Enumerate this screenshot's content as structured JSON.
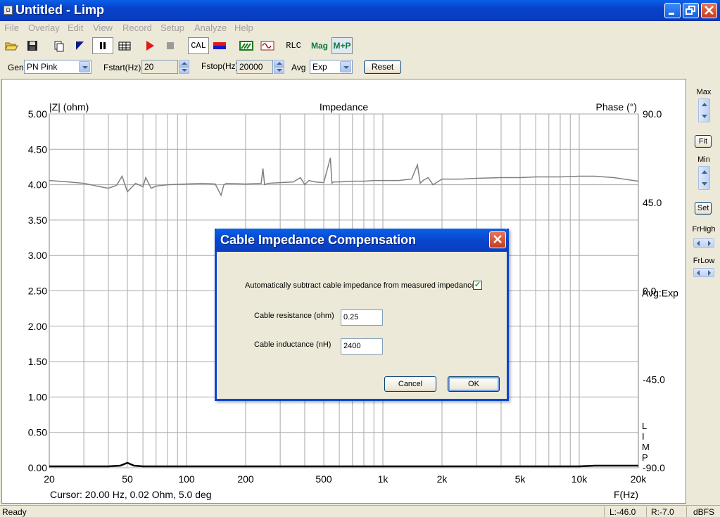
{
  "window": {
    "title": "Untitled - Limp",
    "app_icon_glyph": "Ω"
  },
  "menu": [
    "File",
    "Overlay",
    "Edit",
    "View",
    "Record",
    "Setup",
    "Analyze",
    "Help"
  ],
  "toolbar": {
    "cal_label": "CAL",
    "rlc_label": "RLC",
    "mag_label": "Mag",
    "mp_label": "M+P"
  },
  "params": {
    "gen_label": "Gen",
    "gen_value": "PN Pink",
    "fstart_label": "Fstart(Hz)",
    "fstart_value": "20",
    "fstop_label": "Fstop(Hz)",
    "fstop_value": "20000",
    "avg_label": "Avg",
    "avg_value": "Exp",
    "reset_label": "Reset"
  },
  "side": {
    "max_label": "Max",
    "fit_label": "Fit",
    "min_label": "Min",
    "set_label": "Set",
    "frhigh_label": "FrHigh",
    "frlow_label": "FrLow"
  },
  "chart_data": {
    "type": "line",
    "title": "Impedance",
    "ylabel": "|Z| (ohm)",
    "y2label": "Phase (°)",
    "xlabel": "F(Hz)",
    "xscale": "log",
    "xlim": [
      20,
      20000
    ],
    "ylim": [
      0,
      5
    ],
    "y2lim": [
      -90,
      90
    ],
    "xticks": [
      {
        "v": 20,
        "t": "20"
      },
      {
        "v": 50,
        "t": "50"
      },
      {
        "v": 100,
        "t": "100"
      },
      {
        "v": 200,
        "t": "200"
      },
      {
        "v": 500,
        "t": "500"
      },
      {
        "v": 1000,
        "t": "1k"
      },
      {
        "v": 2000,
        "t": "2k"
      },
      {
        "v": 5000,
        "t": "5k"
      },
      {
        "v": 10000,
        "t": "10k"
      },
      {
        "v": 20000,
        "t": "20k"
      }
    ],
    "yticks": [
      "0.00",
      "0.50",
      "1.00",
      "1.50",
      "2.00",
      "2.50",
      "3.00",
      "3.50",
      "4.00",
      "4.50",
      "5.00"
    ],
    "y2ticks": [
      {
        "v": 90,
        "t": "90.0"
      },
      {
        "v": 45,
        "t": "45.0"
      },
      {
        "v": 0,
        "t": "0.0"
      },
      {
        "v": -45,
        "t": "-45.0"
      },
      {
        "v": -90,
        "t": "-90.0"
      }
    ],
    "avg_label": "Avg:Exp",
    "vertical_label": [
      "L",
      "I",
      "M",
      "P"
    ],
    "grid": true,
    "series": [
      {
        "color": "#808080",
        "x": [
          20,
          25,
          30,
          35,
          40,
          44,
          47,
          50,
          55,
          60,
          62,
          66,
          70,
          80,
          100,
          120,
          140,
          150,
          155,
          160,
          200,
          240,
          245,
          250,
          260,
          300,
          350,
          380,
          400,
          420,
          450,
          500,
          540,
          550,
          560,
          600,
          700,
          800,
          900,
          1000,
          1200,
          1400,
          1500,
          1550,
          1600,
          1700,
          1800,
          2000,
          2500,
          3000,
          4000,
          5000,
          6000,
          8000,
          10000,
          12000,
          15000,
          20000
        ],
        "y": [
          4.06,
          4.04,
          4.02,
          3.98,
          3.95,
          3.99,
          4.12,
          3.9,
          4.02,
          3.97,
          4.1,
          3.95,
          3.98,
          4.0,
          4.01,
          4.02,
          4.01,
          3.85,
          4.0,
          4.02,
          4.01,
          4.02,
          4.23,
          4.0,
          4.02,
          4.03,
          4.04,
          4.1,
          4.0,
          4.06,
          4.04,
          4.03,
          4.38,
          4.02,
          4.04,
          4.04,
          4.05,
          4.05,
          4.06,
          4.06,
          4.06,
          4.08,
          4.28,
          4.02,
          4.06,
          4.1,
          4.0,
          4.08,
          4.08,
          4.09,
          4.1,
          4.1,
          4.11,
          4.11,
          4.12,
          4.12,
          4.1,
          4.05
        ]
      },
      {
        "color": "#000000",
        "x": [
          20,
          40,
          46,
          50,
          54,
          60,
          100,
          1000,
          10000,
          12000,
          15000,
          20000
        ],
        "y": [
          0.02,
          0.02,
          0.03,
          0.07,
          0.03,
          0.02,
          0.02,
          0.02,
          0.02,
          0.03,
          0.03,
          0.03
        ]
      }
    ]
  },
  "cursor_text": "Cursor: 20.00 Hz, 0.02 Ohm, 5.0 deg",
  "dialog": {
    "title": "Cable Impedance Compensation",
    "checkbox_label": "Automatically subtract cable impedance from measured impedance",
    "checkbox_checked": true,
    "resistance_label": "Cable resistance (ohm)",
    "resistance_value": "0.25",
    "inductance_label": "Cable inductance (nH)",
    "inductance_value": "2400",
    "cancel_label": "Cancel",
    "ok_label": "OK"
  },
  "status": {
    "ready": "Ready",
    "left_level": "L:-46.0",
    "right_level": "R:-7.0",
    "units": "dBFS"
  }
}
